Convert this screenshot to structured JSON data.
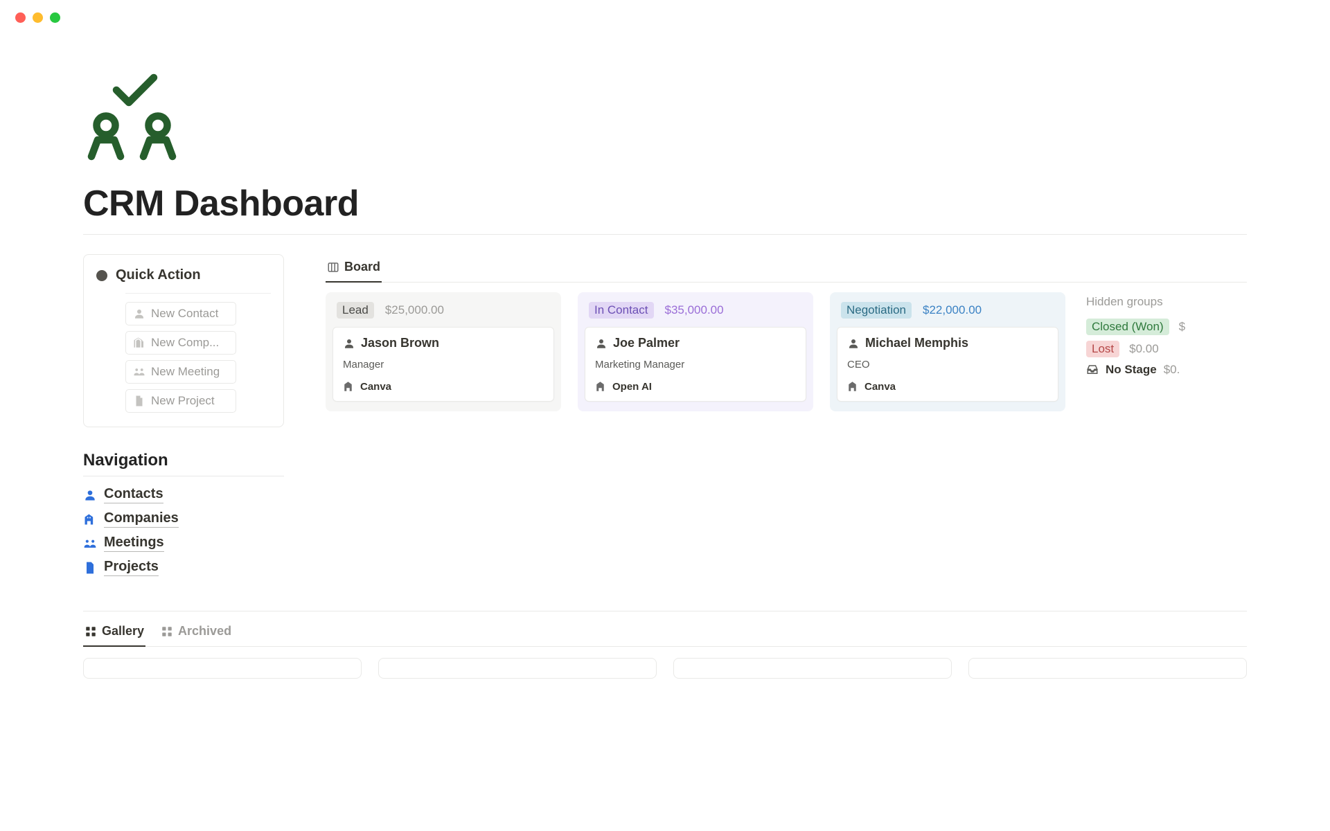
{
  "page": {
    "title": "CRM Dashboard"
  },
  "quick_action": {
    "title": "Quick Action",
    "items": [
      {
        "label": "New Contact"
      },
      {
        "label": "New Comp..."
      },
      {
        "label": "New Meeting"
      },
      {
        "label": "New Project"
      }
    ]
  },
  "navigation": {
    "title": "Navigation",
    "items": [
      {
        "label": "Contacts"
      },
      {
        "label": "Companies"
      },
      {
        "label": "Meetings"
      },
      {
        "label": "Projects"
      }
    ]
  },
  "board": {
    "tab_label": "Board",
    "columns": [
      {
        "stage": "Lead",
        "amount": "$25,000.00",
        "card": {
          "name": "Jason Brown",
          "role": "Manager",
          "company": "Canva"
        }
      },
      {
        "stage": "In Contact",
        "amount": "$35,000.00",
        "card": {
          "name": "Joe Palmer",
          "role": "Marketing Manager",
          "company": "Open AI"
        }
      },
      {
        "stage": "Negotiation",
        "amount": "$22,000.00",
        "card": {
          "name": "Michael Memphis",
          "role": "CEO",
          "company": "Canva"
        }
      }
    ],
    "hidden": {
      "title": "Hidden groups",
      "groups": [
        {
          "label": "Closed (Won)",
          "amount": "$"
        },
        {
          "label": "Lost",
          "amount": "$0.00"
        }
      ],
      "nostage": {
        "label": "No Stage",
        "amount": "$0."
      }
    }
  },
  "bottom_tabs": {
    "gallery": "Gallery",
    "archived": "Archived"
  }
}
